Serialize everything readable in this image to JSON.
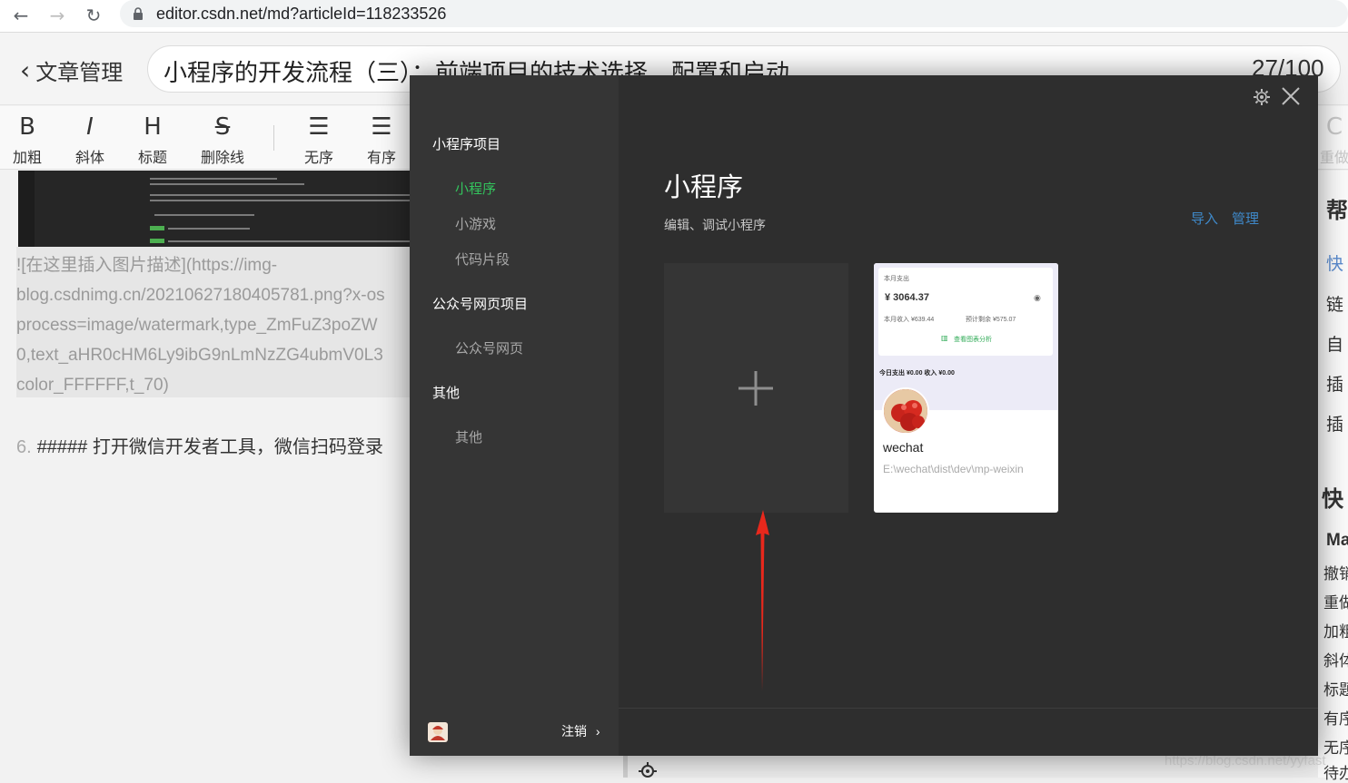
{
  "browser": {
    "url": "editor.csdn.net/md?articleId=118233526",
    "icons": [
      "back-arrow-icon",
      "forward-arrow-icon",
      "reload-icon",
      "lock-icon"
    ]
  },
  "editor": {
    "back_label": "文章管理",
    "title": "小程序的开发流程（三）：前端项目的技术选择、配置和启动",
    "word_count": "27/100",
    "toolbar": [
      {
        "glyph": "B",
        "label": "加粗"
      },
      {
        "glyph": "I",
        "label": "斜体"
      },
      {
        "glyph": "H",
        "label": "标题"
      },
      {
        "glyph": "S",
        "label": "删除线"
      },
      {
        "glyph": "☰",
        "label": "无序"
      },
      {
        "glyph": "☰",
        "label": "有序"
      }
    ],
    "toolbar_right": {
      "glyph": "C",
      "label": "重做"
    },
    "markdown_lines": [
      "![在这里插入图片描述](https://img-",
      "blog.csdnimg.cn/20210627180405781.png?x-os",
      "process=image/watermark,type_ZmFuZ3poZW",
      "0,text_aHR0cHM6Ly9ibG9nLmNzZG4ubmV0L3",
      "color_FFFFFF,t_70)"
    ],
    "step_number": "6.",
    "step_text": "##### 打开微信开发者工具，微信扫码登录",
    "watermark": "https://blog.csdn.net/yyfast"
  },
  "help_panel": {
    "heading": "帮",
    "chips": [
      "快",
      "链",
      "自",
      "插",
      "插"
    ],
    "section": "快",
    "sub": "Ma",
    "items": [
      "撤销",
      "重做",
      "加粗",
      "斜体",
      "标题",
      "有序",
      "无序",
      "待办"
    ]
  },
  "dialog": {
    "sidebar": {
      "sections": [
        {
          "title": "小程序项目",
          "items": [
            "小程序",
            "小游戏",
            "代码片段"
          ]
        },
        {
          "title": "公众号网页项目",
          "items": [
            "公众号网页"
          ]
        },
        {
          "title": "其他",
          "items": [
            "其他"
          ]
        }
      ],
      "active_item": "小程序",
      "logout_label": "注销",
      "logout_chevron": "›"
    },
    "main": {
      "title": "小程序",
      "subtitle": "编辑、调试小程序",
      "import_label": "导入",
      "manage_label": "管理",
      "project": {
        "name": "wechat",
        "path": "E:\\wechat\\dist\\dev\\mp-weixin",
        "preview": {
          "month_label": "本月支出",
          "month_amount": "¥ 3064.37",
          "income": "本月收入 ¥639.44",
          "budget": "预计剩余 ¥575.07",
          "chart_link": "查看图表分析",
          "today": "今日支出 ¥0.00  收入 ¥0.00"
        }
      }
    },
    "colors": {
      "background": "#2e2e2e",
      "sidebar": "#353535",
      "active": "#33c45d",
      "link": "#3f89c9",
      "annotation": "#e8281c"
    }
  }
}
